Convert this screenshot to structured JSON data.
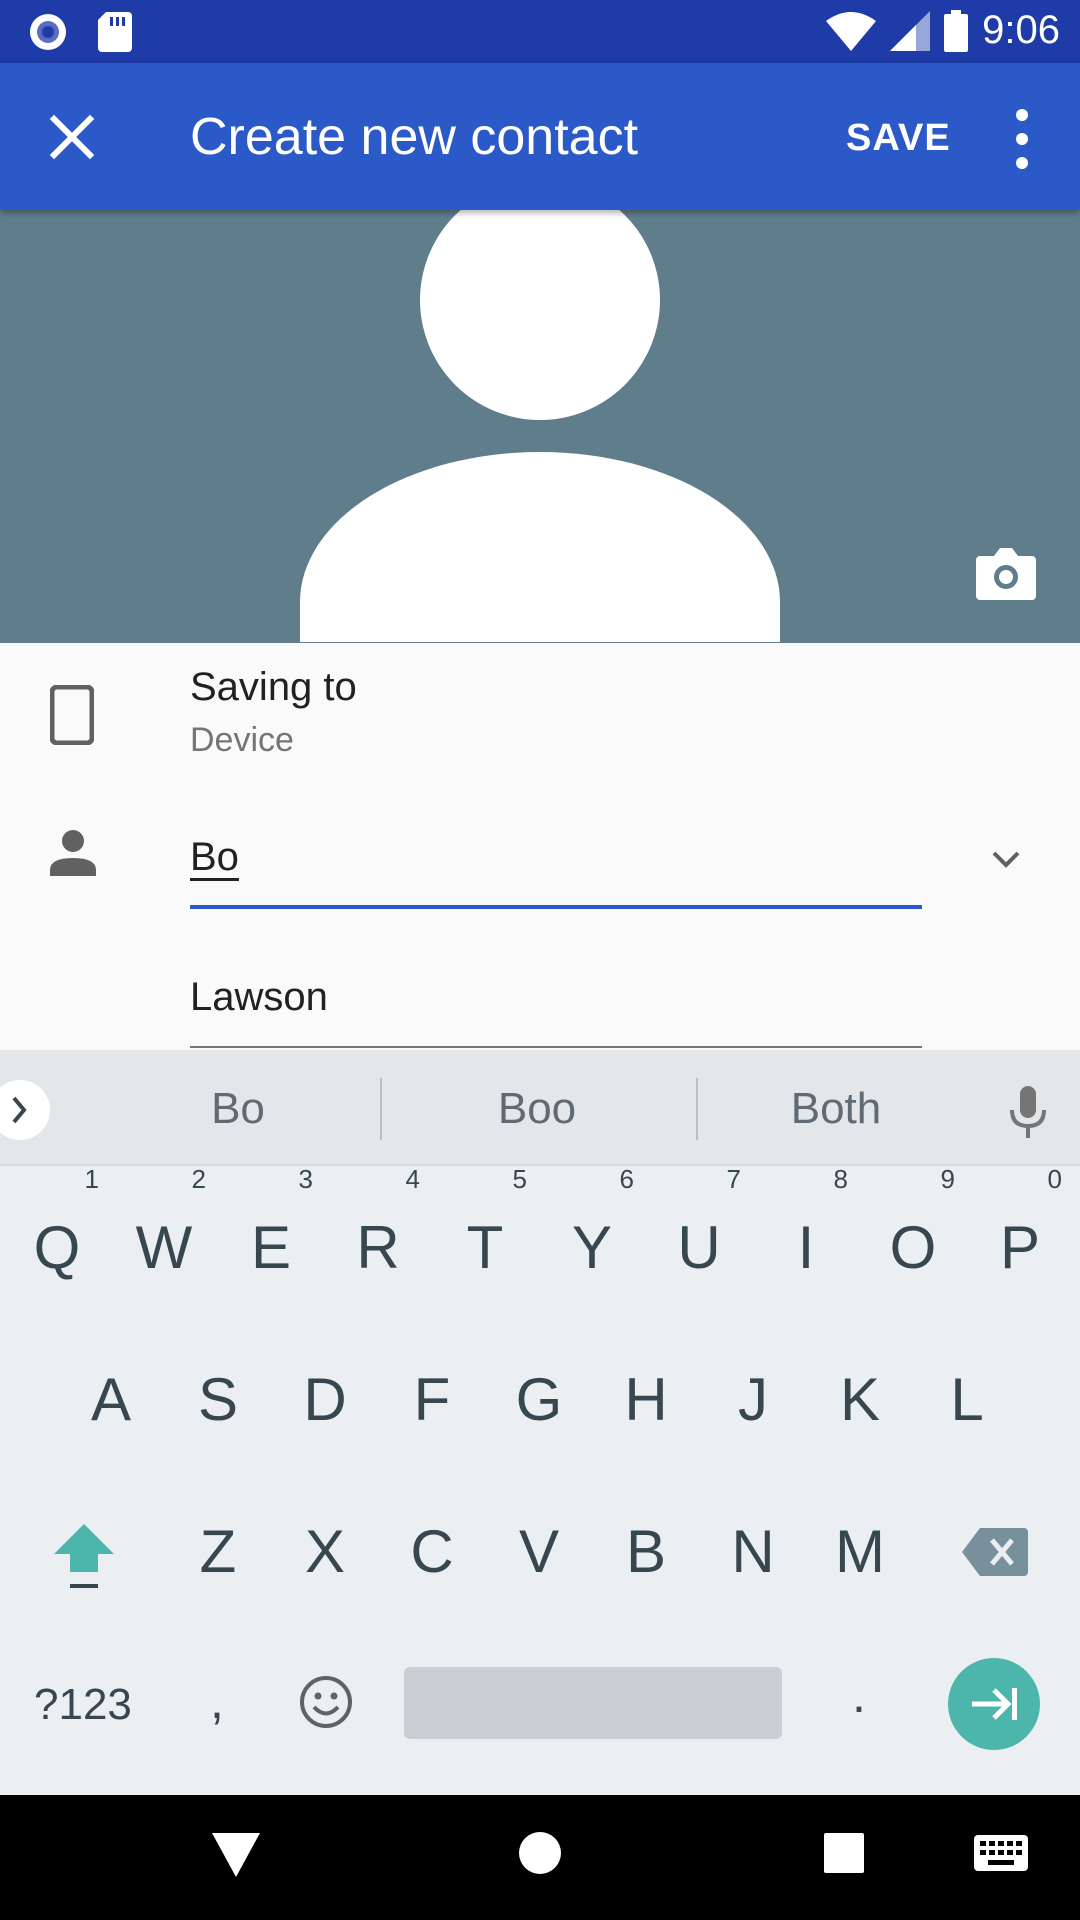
{
  "status_bar": {
    "time": "9:06",
    "icons": [
      "circle-notification-icon",
      "sd-card-icon",
      "wifi-icon",
      "signal-icon",
      "battery-icon"
    ]
  },
  "toolbar": {
    "title": "Create new contact",
    "save_label": "SAVE",
    "icons": {
      "close": "close-icon",
      "more": "more-vert-icon"
    }
  },
  "photo": {
    "camera_icon": "camera-icon"
  },
  "form": {
    "saving_label": "Saving to",
    "saving_value": "Device",
    "first_name": "Bo",
    "last_name": "Lawson"
  },
  "keyboard": {
    "suggestions": [
      "Bo",
      "Boo",
      "Both"
    ],
    "row1": [
      {
        "k": "Q",
        "h": "1"
      },
      {
        "k": "W",
        "h": "2"
      },
      {
        "k": "E",
        "h": "3"
      },
      {
        "k": "R",
        "h": "4"
      },
      {
        "k": "T",
        "h": "5"
      },
      {
        "k": "Y",
        "h": "6"
      },
      {
        "k": "U",
        "h": "7"
      },
      {
        "k": "I",
        "h": "8"
      },
      {
        "k": "O",
        "h": "9"
      },
      {
        "k": "P",
        "h": "0"
      }
    ],
    "row2": [
      "A",
      "S",
      "D",
      "F",
      "G",
      "H",
      "J",
      "K",
      "L"
    ],
    "row3": [
      "Z",
      "X",
      "C",
      "V",
      "B",
      "N",
      "M"
    ],
    "symbols_label": "?123",
    "comma": ",",
    "period": "."
  },
  "colors": {
    "status_bar": "#1e3ba8",
    "toolbar": "#2b5ac8",
    "photo_bg": "#607d8b",
    "accent": "#2b5ac8",
    "enter_key": "#4db6ac"
  }
}
